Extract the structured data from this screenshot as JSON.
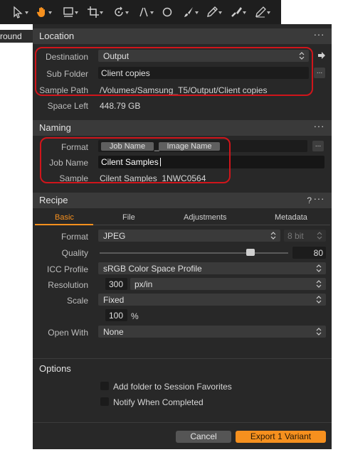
{
  "left_panel": {
    "partial_title": "round"
  },
  "location": {
    "title": "Location",
    "menu_label": "···",
    "destination_label": "Destination",
    "destination_value": "Output",
    "subfolder_label": "Sub Folder",
    "subfolder_value": "Client copies",
    "browse_label": "...",
    "sample_path_label": "Sample Path",
    "sample_path_value": "/Volumes/Samsung_T5/Output/Client copies",
    "space_left_label": "Space Left",
    "space_left_value": "448.79 GB"
  },
  "naming": {
    "title": "Naming",
    "menu_label": "···",
    "format_label": "Format",
    "format_tokens": [
      "Job Name",
      "Image Name"
    ],
    "format_separator": "_",
    "browse_label": "...",
    "job_name_label": "Job Name",
    "job_name_value": "Cilent Samples",
    "sample_label": "Sample",
    "sample_value": "Cilent Samples_1NWC0564"
  },
  "recipe": {
    "title": "Recipe",
    "help_label": "?",
    "menu_label": "···",
    "tabs": [
      "Basic",
      "File",
      "Adjustments",
      "Metadata"
    ],
    "format_label": "Format",
    "format_value": "JPEG",
    "bit_value": "8 bit",
    "quality_label": "Quality",
    "quality_value": "80",
    "quality_fraction": 0.8,
    "icc_label": "ICC Profile",
    "icc_value": "sRGB Color Space Profile",
    "resolution_label": "Resolution",
    "resolution_value": "300",
    "resolution_unit": "px/in",
    "scale_label": "Scale",
    "scale_value": "Fixed",
    "scale_percent_value": "100",
    "percent_symbol": "%",
    "open_with_label": "Open With",
    "open_with_value": "None"
  },
  "options": {
    "title": "Options",
    "checkboxes": [
      "Add folder to Session Favorites",
      "Notify When Completed"
    ]
  },
  "footer": {
    "cancel_label": "Cancel",
    "export_label": "Export 1 Variant"
  },
  "colors": {
    "accent": "#f6901e",
    "highlight_box": "#d0151b",
    "panel_bg": "#282828",
    "section_header_bg": "#3a3a3a"
  },
  "toolbar": {
    "icons": [
      "select-arrow-icon",
      "pan-hand-icon",
      "crop-ruler-icon",
      "crop-icon",
      "rotate-icon",
      "straighten-icon",
      "circle-spot-icon",
      "brush-icon",
      "eraser-pen-icon",
      "fill-icon",
      "draw-mask-icon"
    ]
  }
}
